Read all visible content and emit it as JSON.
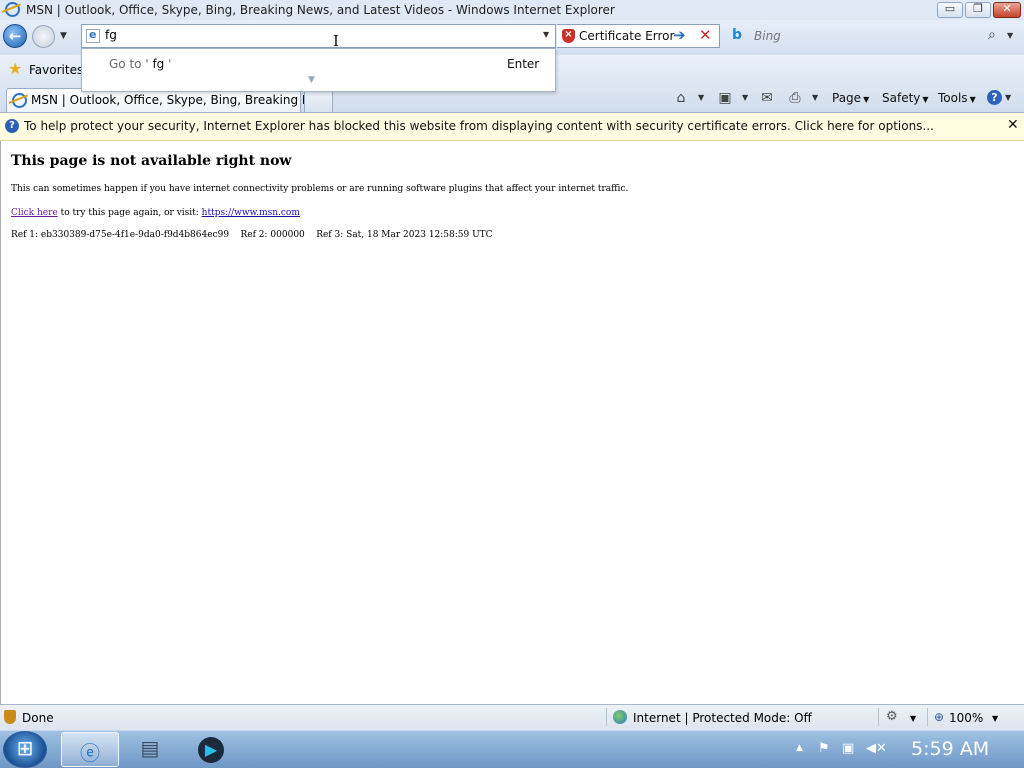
{
  "window": {
    "title": "MSN | Outlook, Office, Skype, Bing, Breaking News, and Latest Videos - Windows Internet Explorer",
    "controls": {
      "minimize": "▭",
      "restore": "❐",
      "close": "✕"
    }
  },
  "nav": {
    "back_glyph": "←",
    "address_value": "fg",
    "cert_error_label": "Certificate Error",
    "go_glyph": "➔",
    "stop_glyph": "✕",
    "search_placeholder": "Bing",
    "search_logo": "b",
    "search_glyph": "⌕"
  },
  "suggestion": {
    "prefix": "Go to '",
    "query": " fg ",
    "suffix": "'",
    "enter_label": "Enter"
  },
  "favorites": {
    "label": "Favorites"
  },
  "tab": {
    "title": "MSN | Outlook, Office, Skype, Bing, Breaking Ne..."
  },
  "commandbar": {
    "page": "Page",
    "safety": "Safety",
    "tools": "Tools",
    "help_glyph": "?"
  },
  "infobar": {
    "message": "To help protect your security, Internet Explorer has blocked this website from displaying content with security certificate errors. Click here for options...",
    "close_glyph": "✕"
  },
  "content": {
    "heading": "This page is not available right now",
    "paragraph": "This can sometimes happen if you have internet connectivity problems or are running software plugins that affect your internet traffic.",
    "retry_link": "Click here",
    "retry_text": " to try this page again, or visit: ",
    "msn_link": "https://www.msn.com",
    "ref_line": "Ref 1: eb330389-d75e-4f1e-9da0-f9d4b864ec99    Ref 2: 000000    Ref 3: Sat, 18 Mar 2023 12:58:59 UTC"
  },
  "statusbar": {
    "status": "Done",
    "zone": "Internet | Protected Mode: Off",
    "zoom": "100%"
  },
  "taskbar": {
    "clock": "5:59 AM"
  },
  "colors": {
    "infobar_bg": "#fffde1",
    "cert_error_red": "#c9302c",
    "link_blue": "#1a0dab",
    "taskbar_blue": "#6f97c6"
  },
  "icons": [
    "ie-icon",
    "back-arrow-icon",
    "forward-icon",
    "cert-error-shield-icon",
    "go-arrow-icon",
    "stop-icon",
    "bing-icon",
    "search-icon",
    "favorites-star-icon",
    "home-icon",
    "feeds-icon",
    "mail-icon",
    "print-icon",
    "help-icon",
    "info-icon",
    "globe-icon",
    "zoom-icon",
    "start-orb-icon"
  ]
}
